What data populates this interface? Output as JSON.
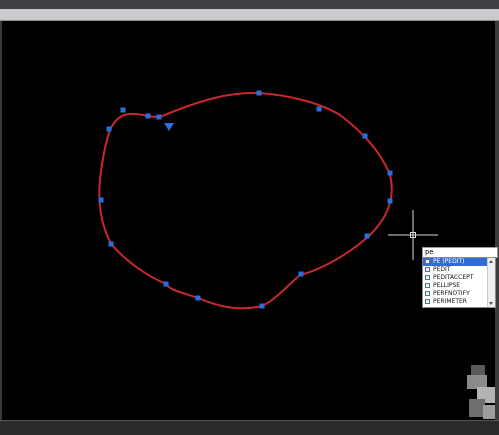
{
  "colors": {
    "canvas_bg": "#000000",
    "spline_stroke": "#c8282d",
    "grip_fill": "#2a6ee0",
    "crosshair": "#d8d8d8",
    "autocomplete_selected_bg": "#2f6cd8"
  },
  "command_line": {
    "typed_text": "pe",
    "suggestions": [
      {
        "label": "PE (PEDIT)",
        "selected": true,
        "icon": "command-alias-icon"
      },
      {
        "label": "PEDIT",
        "selected": false,
        "icon": "command-icon"
      },
      {
        "label": "PEDITACCEPT",
        "selected": false,
        "icon": "system-variable-icon"
      },
      {
        "label": "PELLIPSE",
        "selected": false,
        "icon": "system-variable-icon"
      },
      {
        "label": "PERFNOTIFY",
        "selected": false,
        "icon": "system-variable-icon"
      },
      {
        "label": "PERIMETER",
        "selected": false,
        "icon": "system-variable-icon"
      }
    ]
  },
  "drawing": {
    "object": "closed spline",
    "grips_visible": true
  },
  "icons": {
    "cursor": "crosshair-cursor-icon",
    "direction_grip": "triangle-grip-icon",
    "viewcube": "viewcube-icon",
    "scroll_up": "scroll-up-arrow-icon",
    "scroll_down": "scroll-down-arrow-icon"
  }
}
